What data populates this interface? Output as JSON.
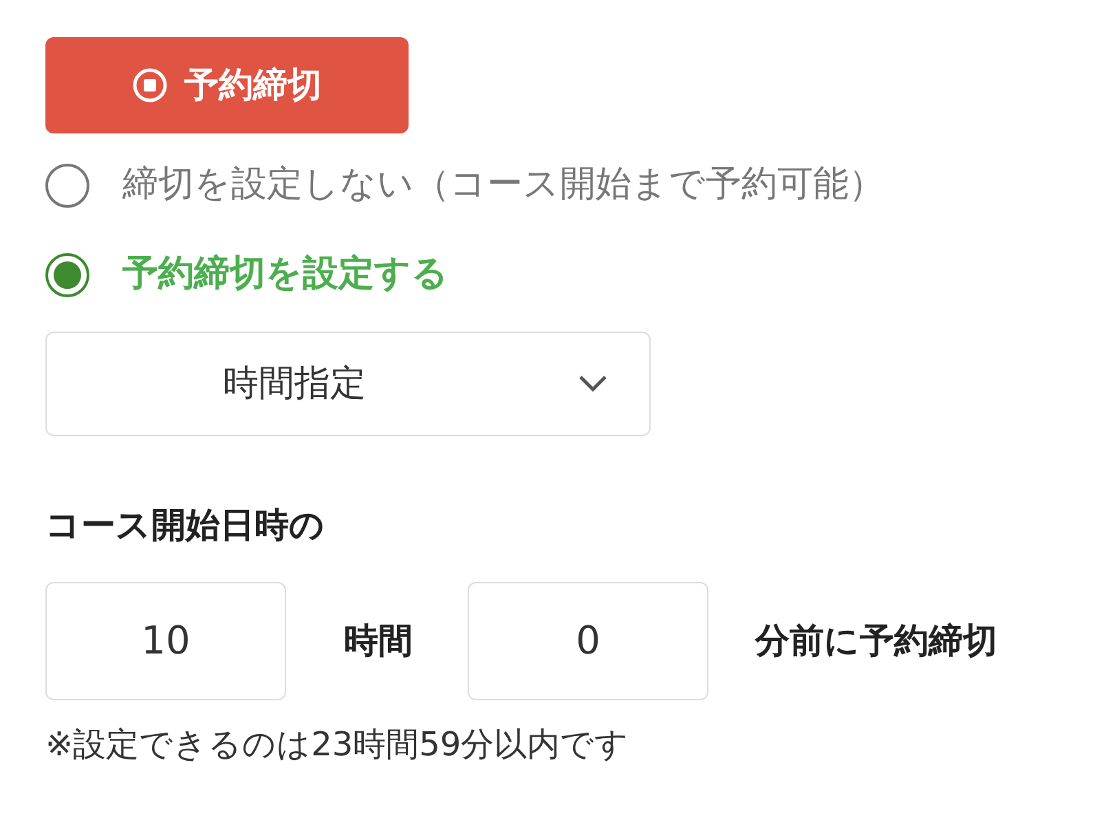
{
  "badge": {
    "label": "予約締切"
  },
  "options": [
    {
      "label": "締切を設定しない（コース開始まで予約可能）",
      "selected": false
    },
    {
      "label": "予約締切を設定する",
      "selected": true
    }
  ],
  "select": {
    "value": "時間指定"
  },
  "offset_label": "コース開始日時の",
  "fields": [
    {
      "value": "10",
      "unit": "時間"
    },
    {
      "value": "0",
      "unit": "分前に予約締切"
    }
  ],
  "note": "※設定できるのは23時間59分以内です"
}
